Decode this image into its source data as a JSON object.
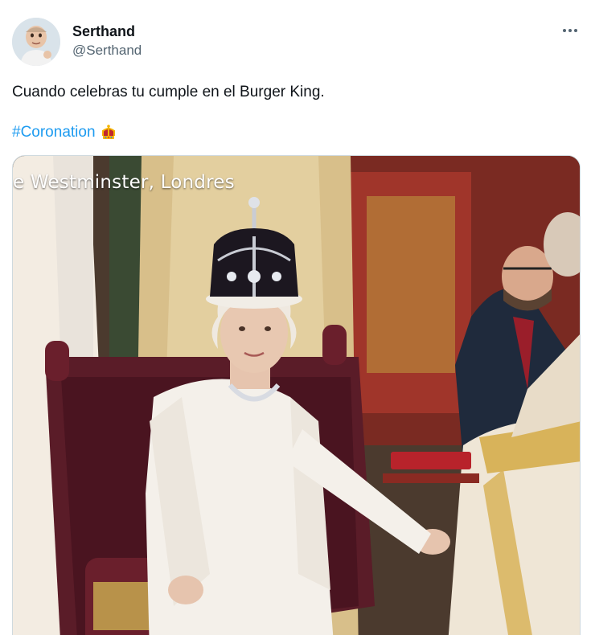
{
  "author": {
    "display_name": "Serthand",
    "handle": "@Serthand"
  },
  "tweet": {
    "text": "Cuando celebras tu cumple en el Burger King.",
    "hashtag": "#Coronation",
    "hashtag_emoji": "crown-emoji-icon"
  },
  "media": {
    "caption": "e Westminster, Londres",
    "description_icon": "photo"
  },
  "colors": {
    "link": "#1d9bf0",
    "secondary_text": "#536471",
    "primary_text": "#0f1419"
  }
}
